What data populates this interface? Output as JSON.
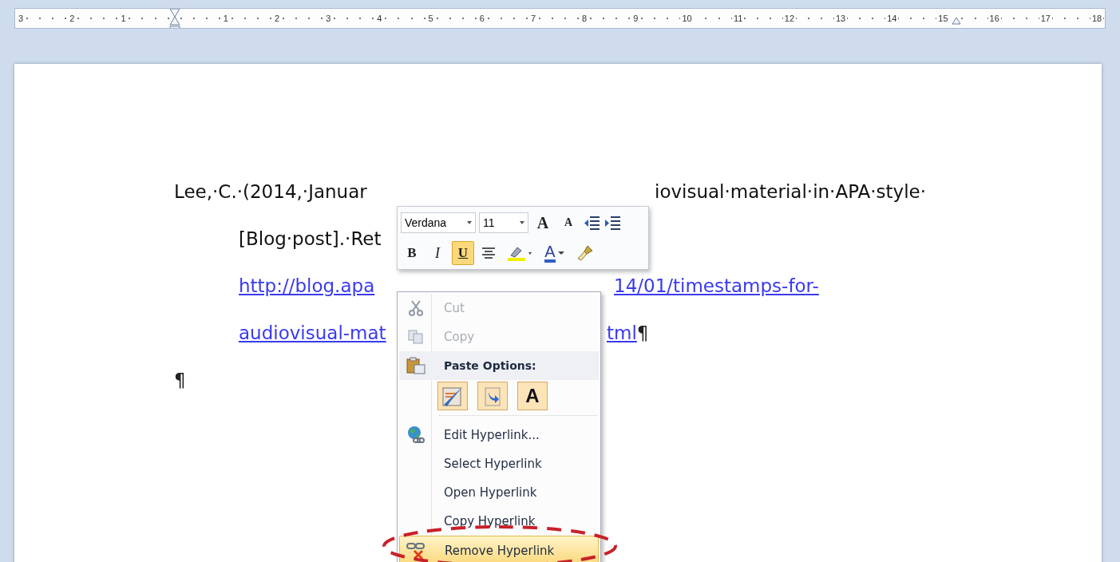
{
  "ruler": {
    "left_labels": [
      "3",
      "2",
      "1"
    ],
    "right_labels": [
      "1",
      "2",
      "3",
      "4",
      "5",
      "6",
      "7",
      "8",
      "9",
      "10",
      "11",
      "12",
      "13",
      "14",
      "15",
      "16",
      "17",
      "18"
    ]
  },
  "document": {
    "lines": [
      {
        "kind": "first",
        "segments": [
          "Lee,·C.·(2014,·Januar",
          "iovisual·material·in·APA·style·"
        ]
      },
      {
        "kind": "indent",
        "segments": [
          "[Blog·post].·Ret"
        ]
      },
      {
        "kind": "link",
        "segments": [
          "http://blog.apa",
          "14/01/timestamps-for-"
        ]
      },
      {
        "kind": "link",
        "segments": [
          "audiovisual-mat",
          "tml"
        ],
        "end_mark": "¶"
      },
      {
        "kind": "mark",
        "segments": [
          "¶"
        ]
      }
    ]
  },
  "mini_toolbar": {
    "font": "Verdana",
    "size": "11",
    "row1": [
      {
        "kind": "grow",
        "glyph": "A"
      },
      {
        "kind": "shrink",
        "glyph": "A"
      },
      {
        "kind": "outdent"
      },
      {
        "kind": "indent"
      }
    ],
    "row2": [
      {
        "kind": "bold",
        "glyph": "B",
        "selected": false
      },
      {
        "kind": "italic",
        "glyph": "I",
        "selected": false
      },
      {
        "kind": "underline",
        "glyph": "U",
        "selected": true
      },
      {
        "kind": "center",
        "selected": false
      },
      {
        "kind": "highlight",
        "selected": false
      },
      {
        "kind": "fontcolor",
        "glyph": "A",
        "selected": false
      },
      {
        "kind": "painter",
        "selected": false
      }
    ]
  },
  "context_menu": {
    "items": [
      {
        "kind": "item",
        "label": "Cut",
        "disabled": true,
        "selected": false
      },
      {
        "kind": "item",
        "label": "Copy",
        "disabled": true,
        "selected": false
      },
      {
        "kind": "header",
        "label": "Paste Options:"
      },
      {
        "kind": "paste_options",
        "options": [
          {
            "kind": "keep"
          },
          {
            "kind": "merge"
          },
          {
            "kind": "text",
            "glyph": "A"
          }
        ]
      },
      {
        "kind": "separator"
      },
      {
        "kind": "item",
        "label": "Edit Hyperlink...",
        "disabled": false,
        "selected": false
      },
      {
        "kind": "item",
        "label": "Select Hyperlink",
        "disabled": false,
        "selected": false
      },
      {
        "kind": "item",
        "label": "Open Hyperlink",
        "disabled": false,
        "selected": false
      },
      {
        "kind": "item",
        "label": "Copy Hyperlink",
        "disabled": false,
        "selected": false
      },
      {
        "kind": "item",
        "label": "Remove Hyperlink",
        "disabled": false,
        "selected": true
      }
    ]
  }
}
